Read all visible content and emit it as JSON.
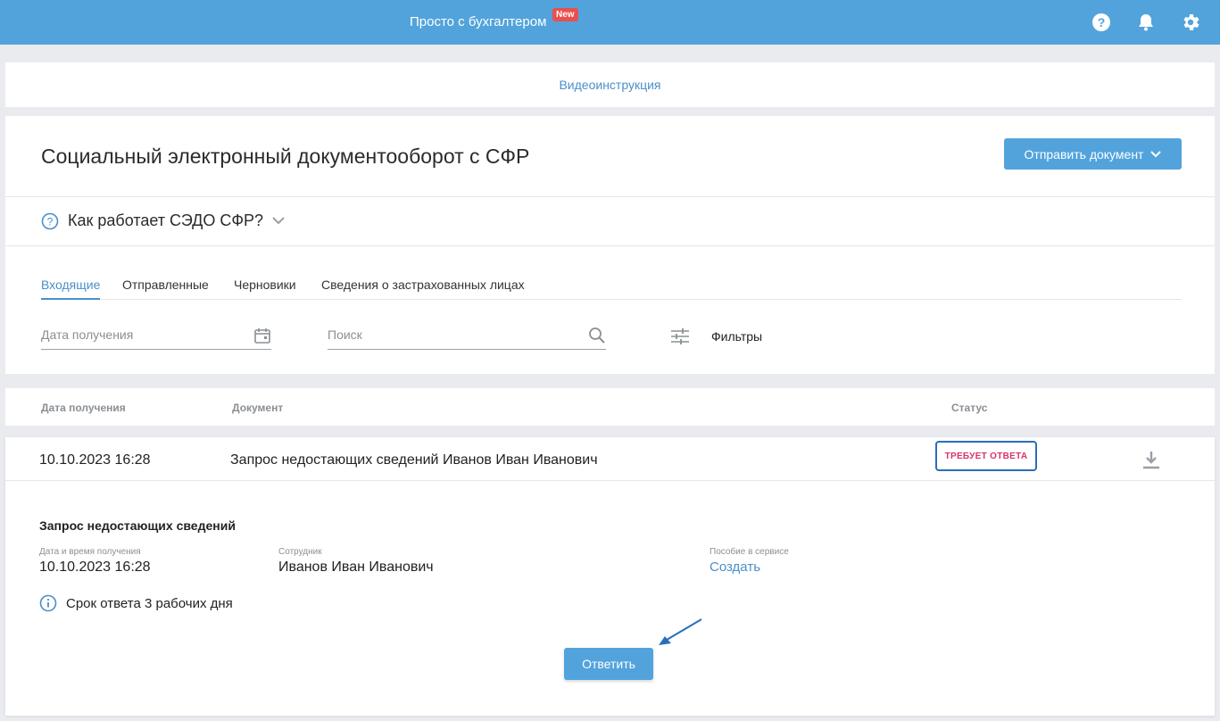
{
  "header": {
    "brand": "Просто с бухгалтером",
    "new_badge": "New",
    "icons": [
      "help-icon",
      "bell-icon",
      "gear-icon"
    ]
  },
  "video_link": "Видеоинструкция",
  "page": {
    "title": "Социальный электронный документооборот с СФР",
    "send_button": "Отправить документ",
    "how_it_works": "Как работает СЭДО СФР?"
  },
  "tabs": [
    {
      "label": "Входящие",
      "active": true
    },
    {
      "label": "Отправленные",
      "active": false
    },
    {
      "label": "Черновики",
      "active": false
    },
    {
      "label": "Сведения о застрахованных лицах",
      "active": false
    }
  ],
  "filters": {
    "date_placeholder": "Дата получения",
    "search_placeholder": "Поиск",
    "filters_label": "Фильтры"
  },
  "table": {
    "columns": [
      "Дата получения",
      "Документ",
      "Статус"
    ],
    "rows": [
      {
        "date": "10.10.2023 16:28",
        "document": "Запрос недостающих сведений Иванов Иван Иванович",
        "status": "ТРЕБУЕТ ОТВЕТА"
      }
    ]
  },
  "detail": {
    "title": "Запрос недостающих сведений",
    "received_label": "Дата и время получения",
    "received_value": "10.10.2023 16:28",
    "employee_label": "Сотрудник",
    "employee_value": "Иванов Иван Иванович",
    "benefit_label": "Пособие в сервисе",
    "benefit_link": "Создать",
    "deadline_text": "Срок ответа 3 рабочих дня",
    "reply_button": "Ответить"
  },
  "colors": {
    "header_bg": "#52a3dc",
    "link": "#4a90c9",
    "status_text": "#d8326a",
    "status_border": "#2a6ebb",
    "badge_bg": "#e8504e"
  }
}
